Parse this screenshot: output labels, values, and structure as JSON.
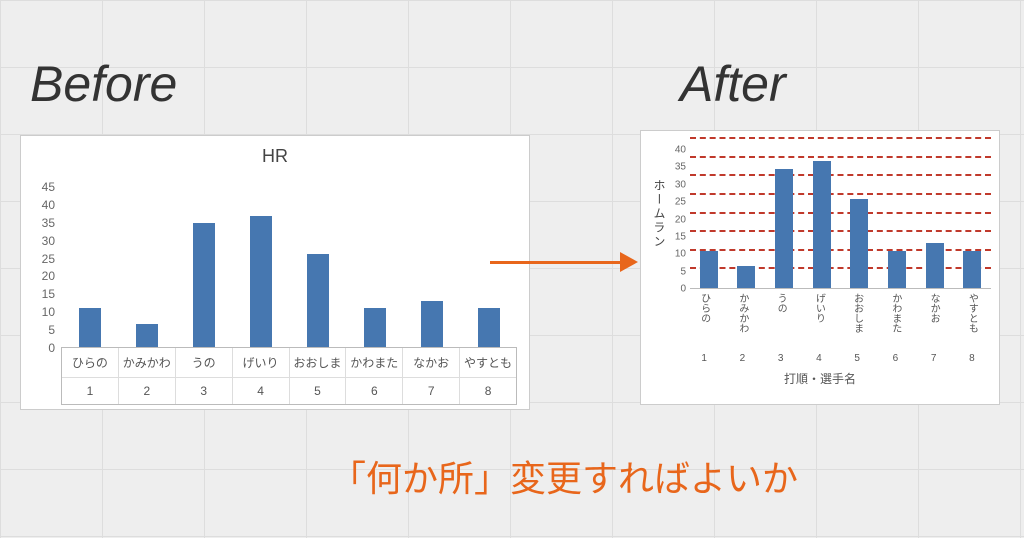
{
  "headings": {
    "before": "Before",
    "after": "After"
  },
  "caption": "「何か所」変更すればよいか",
  "chart_data": [
    {
      "id": "before",
      "type": "bar",
      "title": "HR",
      "xlabel": "",
      "ylabel": "",
      "ylim": [
        0,
        45
      ],
      "yticks": [
        0,
        5,
        10,
        15,
        20,
        25,
        30,
        35,
        40,
        45
      ],
      "categories": [
        "ひらの",
        "かみかわ",
        "うの",
        "げいり",
        "おおしま",
        "かわまた",
        "なかお",
        "やすとも"
      ],
      "numbers": [
        1,
        2,
        3,
        4,
        5,
        6,
        7,
        8
      ],
      "values": [
        10,
        6,
        32,
        34,
        24,
        10,
        12,
        10
      ]
    },
    {
      "id": "after",
      "type": "bar",
      "title": "",
      "xlabel": "打順・選手名",
      "ylabel": "ホームラン",
      "ylim": [
        0,
        40
      ],
      "yticks": [
        0,
        5,
        10,
        15,
        20,
        25,
        30,
        35,
        40
      ],
      "grid": "dashed-red",
      "categories": [
        "ひらの",
        "かみかわ",
        "うの",
        "げいり",
        "おおしま",
        "かわまた",
        "なかお",
        "やすとも"
      ],
      "numbers": [
        1,
        2,
        3,
        4,
        5,
        6,
        7,
        8
      ],
      "values": [
        10,
        6,
        32,
        34,
        24,
        10,
        12,
        10
      ]
    }
  ]
}
